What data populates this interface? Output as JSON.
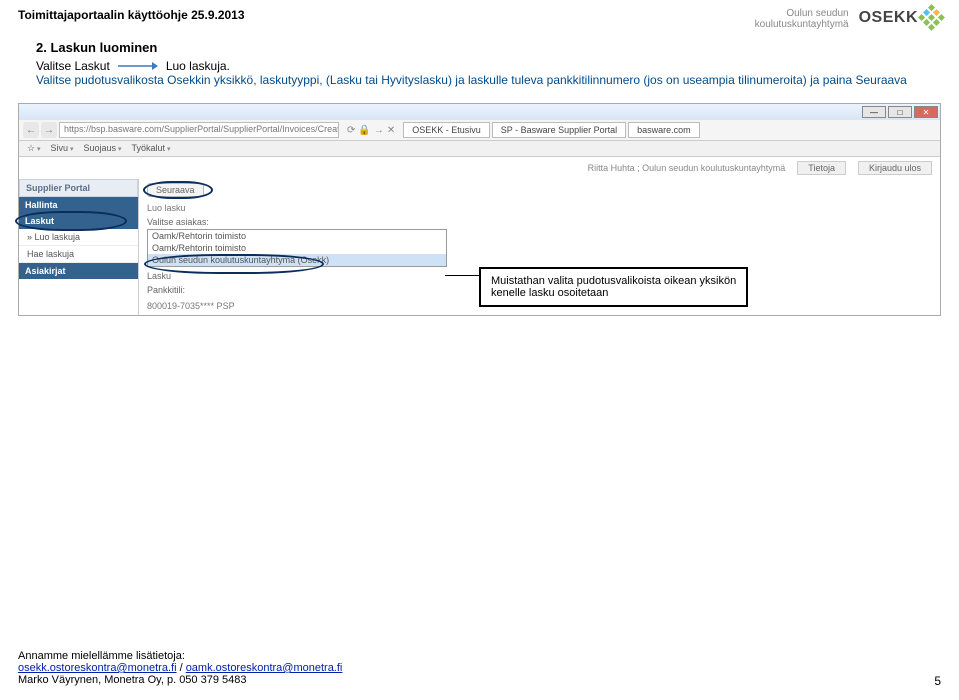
{
  "header": {
    "doc_title": "Toimittajaportaalin käyttöohje 25.9.2013",
    "brand_line1": "Oulun seudun",
    "brand_line2": "koulutuskuntayhtymä",
    "brand_logo": "OSEKK"
  },
  "section": {
    "heading": "2.  Laskun luominen",
    "intro_left": "Valitse Laskut",
    "intro_right": "Luo laskuja.",
    "detail": "Valitse pudotusvalikosta Osekkin yksikkö, laskutyyppi, (Lasku tai Hyvityslasku) ja laskulle tuleva pankkitilinnumero (jos on useampia tilinumeroita) ja paina Seuraava"
  },
  "browser": {
    "url": "https://bsp.basware.com/SupplierPortal/SupplierPortal/Invoices/CreateInvoice.as",
    "tabs": [
      "OSEKK - Etusivu",
      "SP - Basware Supplier Portal",
      "basware.com"
    ],
    "favbar": [
      "Sivu",
      "Suojaus",
      "Työkalut"
    ],
    "win_min": "—",
    "win_max": "□",
    "win_close": "✕",
    "addr_icons": {
      "go": "→",
      "stop": "✕",
      "reload": "⟳",
      "lock": "🔒"
    }
  },
  "portal": {
    "user_meta": "Riitta Huhta ; Oulun seudun koulutuskuntayhtymä",
    "links": [
      "Tietoja",
      "Kirjaudu ulos"
    ],
    "sidebar": {
      "title": "Supplier Portal",
      "nav_hallinta": "Hallinta",
      "nav_laskut": "Laskut",
      "items": [
        "Luo laskuja",
        "Hae laskuja"
      ],
      "nav_asiakirjat": "Asiakirjat"
    },
    "main": {
      "steps": [
        "Seuraava"
      ],
      "crumb": "Luo lasku",
      "select_label": "Valitse asiakas:",
      "options": [
        "Oamk/Rehtorin toimisto",
        "Oamk/Rehtorin toimisto",
        "Oulun seudun koulutuskuntayhtymä (Osekk)"
      ],
      "lasku_label": "Lasku",
      "bank_label": "Pankkitili:",
      "bank_value": "800019-7035**** PSP"
    }
  },
  "callout": {
    "line1": "Muistathan valita pudotusvalikoista oikean yksikön",
    "line2": "kenelle lasku osoitetaan"
  },
  "footer": {
    "info_label": "Annamme mielellämme lisätietoja:",
    "email1": "osekk.ostoreskontra@monetra.fi",
    "separator": " / ",
    "email2": "oamk.ostoreskontra@monetra.fi",
    "contact": "Marko Väyrynen, Monetra Oy, p. 050 379 5483",
    "page": "5"
  }
}
